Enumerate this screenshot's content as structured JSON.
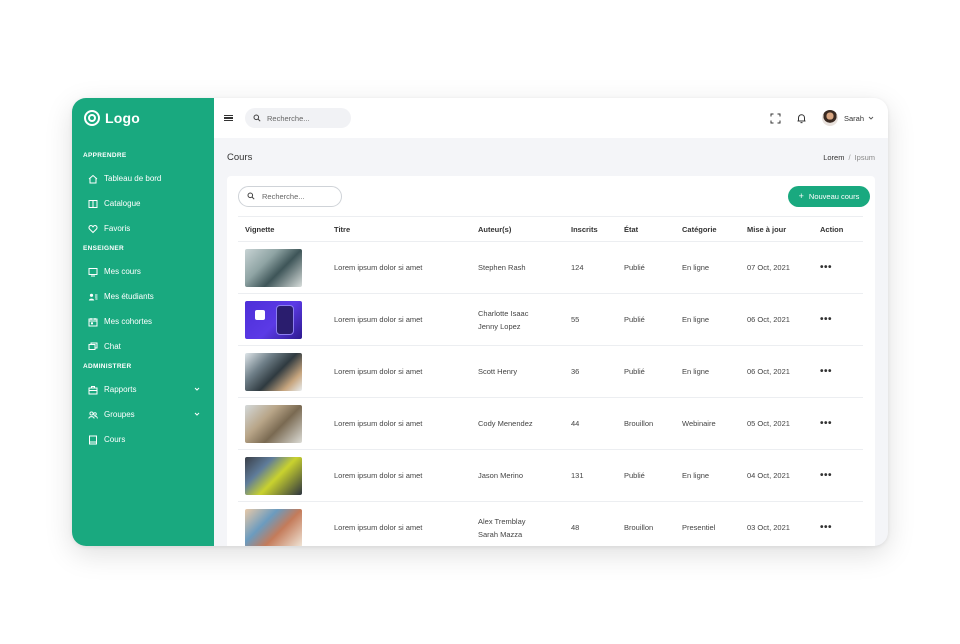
{
  "sidebar": {
    "logo_text": "Logo",
    "sections": [
      {
        "title": "APPRENDRE",
        "items": [
          {
            "label": "Tableau de bord",
            "icon": "home-icon"
          },
          {
            "label": "Catalogue",
            "icon": "book-open-icon"
          },
          {
            "label": "Favoris",
            "icon": "heart-icon"
          }
        ]
      },
      {
        "title": "ENSEIGNER",
        "items": [
          {
            "label": "Mes cours",
            "icon": "monitor-icon"
          },
          {
            "label": "Mes étudiants",
            "icon": "users-icon"
          },
          {
            "label": "Mes cohortes",
            "icon": "calendar-icon"
          },
          {
            "label": "Chat",
            "icon": "chat-icon"
          }
        ]
      },
      {
        "title": "ADMINISTRER",
        "items": [
          {
            "label": "Rapports",
            "icon": "briefcase-icon",
            "expandable": true
          },
          {
            "label": "Groupes",
            "icon": "group-icon",
            "expandable": true
          },
          {
            "label": "Cours",
            "icon": "book-icon"
          }
        ]
      }
    ]
  },
  "topbar": {
    "search_placeholder": "Recherche...",
    "user_name": "Sarah"
  },
  "page": {
    "title": "Cours",
    "breadcrumb": [
      "Lorem",
      "Ipsum"
    ]
  },
  "card": {
    "search_placeholder": "Recherche...",
    "new_button_label": "Nouveau cours"
  },
  "table": {
    "columns": [
      "Vignette",
      "Titre",
      "Auteur(s)",
      "Inscrits",
      "État",
      "Catégorie",
      "Mise à jour",
      "Action"
    ],
    "rows": [
      {
        "title": "Lorem ipsum dolor si amet",
        "authors": [
          "Stephen Rash"
        ],
        "enrolled": "124",
        "state": "Publié",
        "category": "En ligne",
        "updated": "07 Oct, 2021",
        "action": "•••"
      },
      {
        "title": "Lorem ipsum dolor si amet",
        "authors": [
          "Charlotte Isaac",
          "Jenny Lopez"
        ],
        "enrolled": "55",
        "state": "Publié",
        "category": "En ligne",
        "updated": "06 Oct, 2021",
        "action": "•••"
      },
      {
        "title": "Lorem ipsum dolor si amet",
        "authors": [
          "Scott Henry"
        ],
        "enrolled": "36",
        "state": "Publié",
        "category": "En ligne",
        "updated": "06 Oct, 2021",
        "action": "•••"
      },
      {
        "title": "Lorem ipsum dolor si amet",
        "authors": [
          "Cody Menendez"
        ],
        "enrolled": "44",
        "state": "Brouillon",
        "category": "Webinaire",
        "updated": "05 Oct, 2021",
        "action": "•••"
      },
      {
        "title": "Lorem ipsum dolor si amet",
        "authors": [
          "Jason Merino"
        ],
        "enrolled": "131",
        "state": "Publié",
        "category": "En ligne",
        "updated": "04 Oct, 2021",
        "action": "•••"
      },
      {
        "title": "Lorem ipsum dolor si amet",
        "authors": [
          "Alex Tremblay",
          "Sarah Mazza"
        ],
        "enrolled": "48",
        "state": "Brouillon",
        "category": "Presentiel",
        "updated": "03 Oct, 2021",
        "action": "•••"
      }
    ]
  },
  "colors": {
    "accent": "#19a97f",
    "background": "#f4f5f8"
  }
}
